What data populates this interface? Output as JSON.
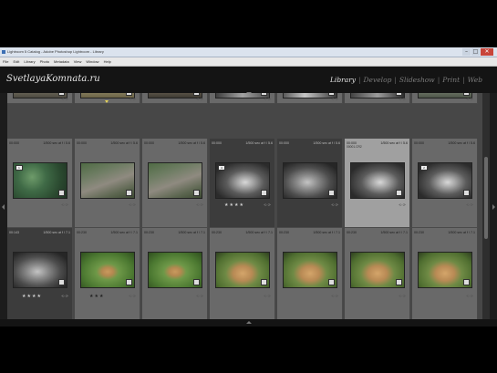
{
  "window": {
    "title": "Lightroom 5 Catalog - Adobe Photoshop Lightroom - Library"
  },
  "menu": [
    "File",
    "Edit",
    "Library",
    "Photo",
    "Metadata",
    "View",
    "Window",
    "Help"
  ],
  "header": {
    "brand": "SvetlayaKomnata.ru",
    "modules": [
      {
        "label": "Library",
        "active": true
      },
      {
        "label": "Develop",
        "active": false
      },
      {
        "label": "Slideshow",
        "active": false
      },
      {
        "label": "Print",
        "active": false
      },
      {
        "label": "Web",
        "active": false
      }
    ]
  },
  "rows": [
    {
      "cells": [
        {
          "tone": "normal",
          "scene": "zoo-top-a",
          "stars": ""
        },
        {
          "tone": "normal",
          "scene": "zoo-top-b",
          "stars": "",
          "flag": true
        },
        {
          "tone": "normal",
          "scene": "zoo-top-c",
          "stars": ""
        },
        {
          "tone": "normal",
          "scene": "zoo-top-d",
          "stars": ""
        },
        {
          "tone": "normal",
          "scene": "zoo-top-e",
          "stars": ""
        },
        {
          "tone": "normal",
          "scene": "zoo-top-f",
          "stars": ""
        },
        {
          "tone": "normal",
          "scene": "zoo-top-g",
          "stars": ""
        }
      ]
    },
    {
      "cells": [
        {
          "tone": "normal",
          "meta_left": "00:000",
          "meta_right": "1/500 sec at f / 5.6",
          "scene": "jungle",
          "badge": "1",
          "stars": ""
        },
        {
          "tone": "normal",
          "meta_left": "00:000",
          "meta_right": "1/500 sec at f / 5.6",
          "scene": "rocks-green",
          "stars": ""
        },
        {
          "tone": "normal",
          "meta_left": "00:000",
          "meta_right": "1/500 sec at f / 5.6",
          "scene": "rocks-green",
          "stars": ""
        },
        {
          "tone": "dark",
          "meta_left": "00:000",
          "meta_right": "1/500 sec at f / 5.6",
          "scene": "tiger-bw",
          "badge": "4",
          "stars": "★★★★"
        },
        {
          "tone": "dark",
          "meta_left": "00:000",
          "meta_right": "1/500 sec at f / 5.6",
          "scene": "tiger-gray",
          "stars": ""
        },
        {
          "tone": "light",
          "meta_left": "00:000",
          "meta_right": "1/500 sec at f / 5.6",
          "name": "00001.CR2",
          "scene": "tiger-bw",
          "stars": ""
        },
        {
          "tone": "normal",
          "meta_left": "00:000",
          "meta_right": "1/500 sec at f / 5.6",
          "scene": "tiger-bw",
          "badge": "2",
          "stars": ""
        }
      ]
    },
    {
      "cells": [
        {
          "tone": "dark",
          "meta_left": "00:143",
          "meta_right": "1/500 sec at f / 7.1",
          "scene": "tiger-gray",
          "stars": "★★★★"
        },
        {
          "tone": "normal",
          "meta_left": "00:230",
          "meta_right": "1/500 sec at f / 7.1",
          "scene": "lion-grass",
          "stars": "★★★"
        },
        {
          "tone": "normal",
          "meta_left": "00:230",
          "meta_right": "1/500 sec at f / 7.1",
          "scene": "lion-grass",
          "stars": ""
        },
        {
          "tone": "normal",
          "meta_left": "00:230",
          "meta_right": "1/500 sec at f / 7.1",
          "scene": "lions-rest",
          "stars": ""
        },
        {
          "tone": "normal",
          "meta_left": "00:230",
          "meta_right": "1/500 sec at f / 7.1",
          "scene": "lions-rest",
          "stars": ""
        },
        {
          "tone": "normal",
          "meta_left": "00:230",
          "meta_right": "1/500 sec at f / 7.1",
          "scene": "lions-rest",
          "stars": ""
        },
        {
          "tone": "normal",
          "meta_left": "00:230",
          "meta_right": "1/500 sec at f / 7.1",
          "scene": "lions-rest",
          "stars": ""
        }
      ]
    }
  ]
}
